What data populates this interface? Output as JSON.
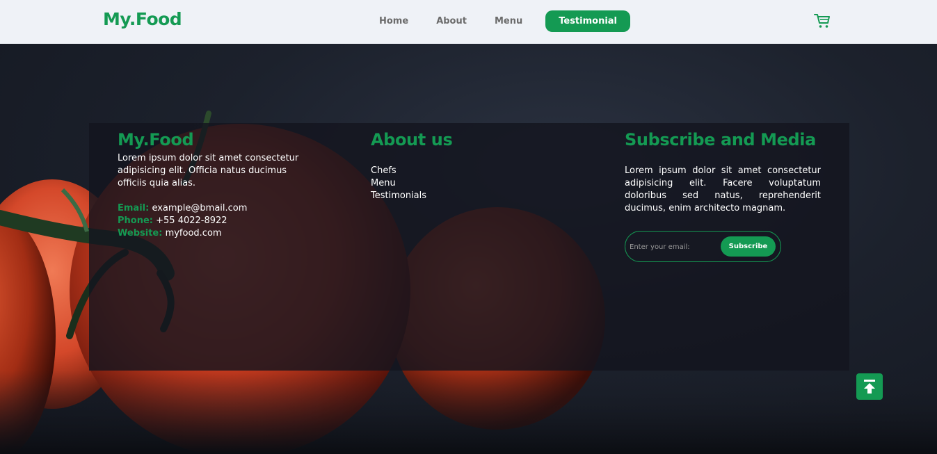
{
  "header": {
    "logo": "My.Food",
    "nav": [
      {
        "label": "Home"
      },
      {
        "label": "About"
      },
      {
        "label": "Menu"
      },
      {
        "label": "Testimonial",
        "active": true
      }
    ],
    "cart_icon": "cart-icon"
  },
  "footer": {
    "brand": {
      "title": "My.Food",
      "description": "Lorem ipsum dolor sit amet consectetur adipisicing elit. Officia natus ducimus officiis quia alias.",
      "email_label": "Email:",
      "email": "example@bmail.com",
      "phone_label": "Phone:",
      "phone": "+55 4022-8922",
      "website_label": "Website:",
      "website": "myfood.com"
    },
    "about": {
      "title": "About us",
      "links": [
        "Chefs",
        "Menu",
        "Testimonials"
      ]
    },
    "subscribe": {
      "title": "Subscribe and Media",
      "description": "Lorem ipsum dolor sit amet consectetur adipisicing elit. Facere voluptatum doloribus sed natus, reprehenderit ducimus, enim architecto magnam.",
      "email_placeholder": "Enter your email:",
      "button_label": "Subscribe"
    }
  },
  "scroll_top_icon": "arrow-up-to-top-icon",
  "colors": {
    "accent": "#149a53",
    "header_bg": "#eff2f7",
    "panel_bg": "#14151e"
  }
}
